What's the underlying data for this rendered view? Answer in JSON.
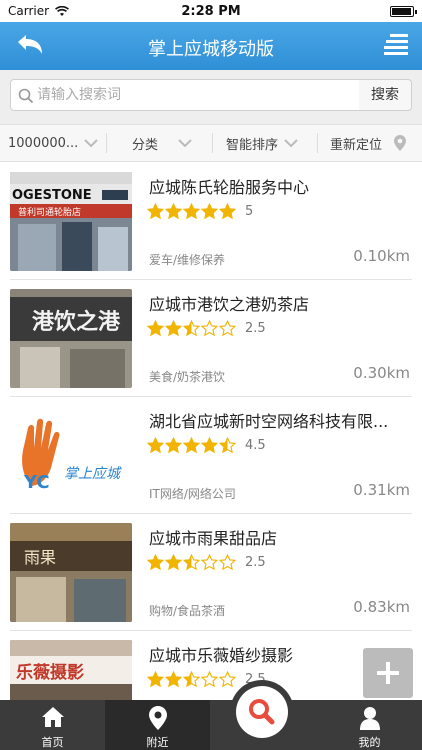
{
  "status_bar": {
    "carrier": "Carrier",
    "time": "2:28 PM"
  },
  "nav": {
    "title": "掌上应城移动版",
    "back_icon": "back-arrow-icon",
    "menu_icon": "list-menu-icon"
  },
  "search": {
    "placeholder": "请输入搜索词",
    "button_label": "搜索"
  },
  "filters": {
    "distance": "1000000...",
    "category": "分类",
    "sort": "智能排序",
    "relocate": "重新定位"
  },
  "colors": {
    "accent": "#3498db",
    "star": "#f1b400",
    "tabbar": "#3b3b3b",
    "search_red": "#e74c3c"
  },
  "listings": [
    {
      "name": "应城陈氏轮胎服务中心",
      "stars": 5,
      "rating": "5",
      "category": "爱车/维修保养",
      "distance": "0.10km"
    },
    {
      "name": "应城市港饮之港奶茶店",
      "stars": 2.5,
      "rating": "2.5",
      "category": "美食/奶茶港饮",
      "distance": "0.30km"
    },
    {
      "name": "湖北省应城新时空网络科技有限...",
      "stars": 4.5,
      "rating": "4.5",
      "category": "IT网络/网络公司",
      "distance": "0.31km"
    },
    {
      "name": "应城市雨果甜品店",
      "stars": 2.5,
      "rating": "2.5",
      "category": "购物/食品茶酒",
      "distance": "0.83km"
    },
    {
      "name": "应城市乐薇婚纱摄影",
      "stars": 2.5,
      "rating": "2.5",
      "category": "",
      "distance": ""
    }
  ],
  "thumb_text": {
    "tire_sign": "OGESTONE",
    "tire_sub": "普利司通轮胎店",
    "tea_sign": "港饮之港",
    "logo_yc": "YC",
    "logo_text": "掌上应城",
    "dessert_sign": "雨果",
    "wedding_sign": "乐薇摄影"
  },
  "tabs": [
    {
      "label": "首页",
      "icon": "home-icon"
    },
    {
      "label": "附近",
      "icon": "location-pin-icon"
    },
    {
      "label": "我的",
      "icon": "user-icon"
    }
  ]
}
